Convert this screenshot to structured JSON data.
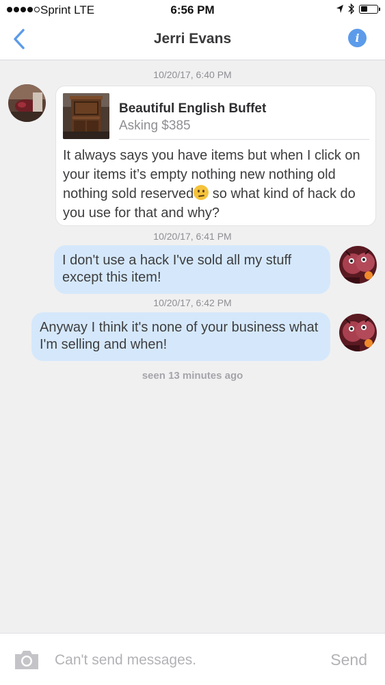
{
  "status_bar": {
    "signal_dots": 5,
    "signal_filled": 4,
    "carrier": "Sprint  LTE",
    "time": "6:56 PM",
    "battery_level": 0.3
  },
  "nav": {
    "title": "Jerri Evans",
    "back_icon": "chevron-left-icon",
    "info_icon": "info-icon",
    "accent_color": "#5b9bea"
  },
  "conversation": {
    "messages": [
      {
        "timestamp": "10/20/17, 6:40 PM",
        "direction": "received",
        "item": {
          "title": "Beautiful English Buffet",
          "price": "Asking $385"
        },
        "text_before_emoji": "It always says you have items but when I click on your items it’s empty nothing new nothing old nothing sold reserved",
        "emoji": "thinking-face-emoji",
        "text_after_emoji": " so what kind of hack do you use for that and why?"
      },
      {
        "timestamp": "10/20/17, 6:41 PM",
        "direction": "sent",
        "text": "I don't use a hack I've sold all my stuff except this item!"
      },
      {
        "timestamp": "10/20/17, 6:42 PM",
        "direction": "sent",
        "text": "Anyway I  think it's none of your business what I'm selling and when!"
      }
    ],
    "seen": "seen 13 minutes ago",
    "sent_bubble_color": "#d5e8fb"
  },
  "composer": {
    "camera_icon": "camera-icon",
    "placeholder": "Can't send messages.",
    "send_label": "Send"
  }
}
